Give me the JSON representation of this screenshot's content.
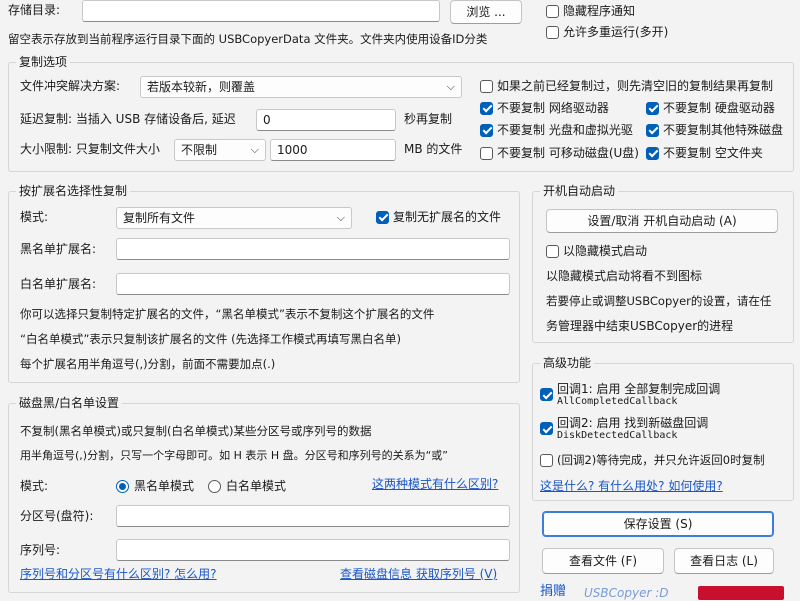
{
  "storage": {
    "label": "存储目录:",
    "value": "",
    "browse_button": "浏览 ...",
    "hint": "留空表示存放到当前程序运行目录下面的 USBCopyerData 文件夹。文件夹内使用设备ID分类"
  },
  "top_options": {
    "hide_notify": {
      "label": "隐藏程序通知",
      "checked": false
    },
    "allow_multi": {
      "label": "允许多重运行(多开)",
      "checked": false
    }
  },
  "copy_options": {
    "title": "复制选项",
    "conflict_label": "文件冲突解决方案:",
    "conflict_value": "若版本较新，则覆盖",
    "delay_label": "延迟复制: 当插入 USB 存储设备后, 延迟",
    "delay_value": "0",
    "delay_unit": "秒再复制",
    "size_label": "大小限制: 只复制文件大小",
    "size_mode": "不限制",
    "size_value": "1000",
    "size_unit": "MB 的文件",
    "clear_previous": {
      "label": "如果之前已经复制过，则先清空旧的复制结果再复制",
      "checked": false
    },
    "checks": [
      {
        "label": "不要复制 网络驱动器",
        "checked": true
      },
      {
        "label": "不要复制 硬盘驱动器",
        "checked": true
      },
      {
        "label": "不要复制 光盘和虚拟光驱",
        "checked": true
      },
      {
        "label": "不要复制其他特殊磁盘",
        "checked": true
      },
      {
        "label": "不要复制 可移动磁盘(U盘)",
        "checked": false
      },
      {
        "label": "不要复制 空文件夹",
        "checked": true
      }
    ]
  },
  "ext_copy": {
    "title": "按扩展名选择性复制",
    "mode_label": "模式:",
    "mode_value": "复制所有文件",
    "copy_no_ext": {
      "label": "复制无扩展名的文件",
      "checked": true
    },
    "blacklist_label": "黑名单扩展名:",
    "blacklist_value": "",
    "whitelist_label": "白名单扩展名:",
    "whitelist_value": "",
    "desc1": "你可以选择只复制特定扩展名的文件，“黑名单模式”表示不复制这个扩展名的文件",
    "desc2": "“白名单模式”表示只复制该扩展名的文件   (先选择工作模式再填写黑白名单)",
    "desc3": "每个扩展名用半角逗号(,)分割，前面不需要加点(.)"
  },
  "autostart": {
    "title": "开机自动启动",
    "toggle_button": "设置/取消 开机自动启动 (A)",
    "hidden_mode": {
      "label": "以隐藏模式启动",
      "checked": false
    },
    "desc1": "以隐藏模式启动将看不到图标",
    "desc2": "若要停止或调整USBCopyer的设置，请在任",
    "desc3": "务管理器中结束USBCopyer的进程"
  },
  "disk_list": {
    "title": "磁盘黑/白名单设置",
    "desc1": "不复制(黑名单模式)或只复制(白名单模式)某些分区号或序列号的数据",
    "desc2": "用半角逗号(,)分割，只写一个字母即可。如 H 表示 H 盘。分区号和序列号的关系为“或”",
    "mode_label": "模式:",
    "mode_black": {
      "label": "黑名单模式",
      "selected": true
    },
    "mode_white": {
      "label": "白名单模式",
      "selected": false
    },
    "mode_diff_link": "这两种模式有什么区别?",
    "partition_label": "分区号(盘符):",
    "partition_value": "",
    "serial_label": "序列号:",
    "serial_value": "",
    "diff_link": "序列号和分区号有什么区别? 怎么用?",
    "view_link": "查看磁盘信息 获取序列号 (V)"
  },
  "advanced": {
    "title": "高级功能",
    "callback1": {
      "label": "回调1: 启用 全部复制完成回调",
      "code": "AllCompletedCallback",
      "checked": true
    },
    "callback2": {
      "label": "回调2: 启用 找到新磁盘回调",
      "code": "DiskDetectedCallback",
      "checked": true
    },
    "wait_option": {
      "label": "(回调2)等待完成，并只允许返回0时复制",
      "checked": false
    },
    "help_link": "这是什么? 有什么用处? 如何使用?"
  },
  "actions": {
    "save": "保存设置 (S)",
    "view_files": "查看文件 (F)",
    "view_log": "查看日志 (L)",
    "donate": "捐赠",
    "brand": "USBCopyer :D"
  }
}
